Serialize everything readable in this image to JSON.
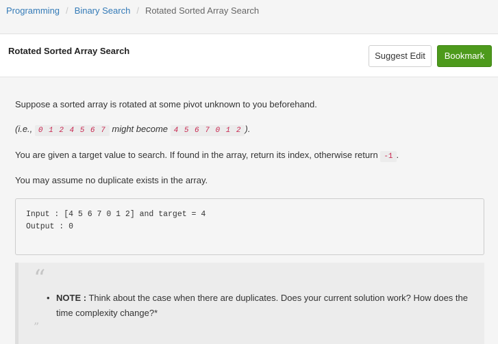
{
  "breadcrumb": {
    "items": [
      "Programming",
      "Binary Search",
      "Rotated Sorted Array Search"
    ],
    "separator": "/"
  },
  "problem": {
    "title": "Rotated Sorted Array Search",
    "suggest_edit_label": "Suggest Edit",
    "bookmark_label": "Bookmark"
  },
  "description": {
    "p1": "Suppose a sorted array is rotated at some pivot unknown to you beforehand.",
    "p2_prefix": "(i.e.,",
    "p2_code1": "0 1 2 4 5 6 7",
    "p2_mid": "might become",
    "p2_code2": "4 5 6 7 0 1 2",
    "p2_suffix": ").",
    "p3_prefix": "You are given a target value to search. If found in the array, return its index, otherwise return",
    "p3_code": "-1",
    "p3_suffix": ".",
    "p4": "You may assume no duplicate exists in the array."
  },
  "example": {
    "input_line": "Input : [4 5 6 7 0 1 2] and target = 4",
    "output_line": "Output : 0"
  },
  "note": {
    "open_quote": "“",
    "close_quote": "”",
    "label": "NOTE :",
    "text": "Think about the case when there are duplicates. Does your current solution work? How does the time complexity change?*",
    "bullet": "•"
  },
  "colors": {
    "link": "#337ab7",
    "bookmark_bg": "#4d9a1c",
    "code_text": "#c7254e"
  }
}
